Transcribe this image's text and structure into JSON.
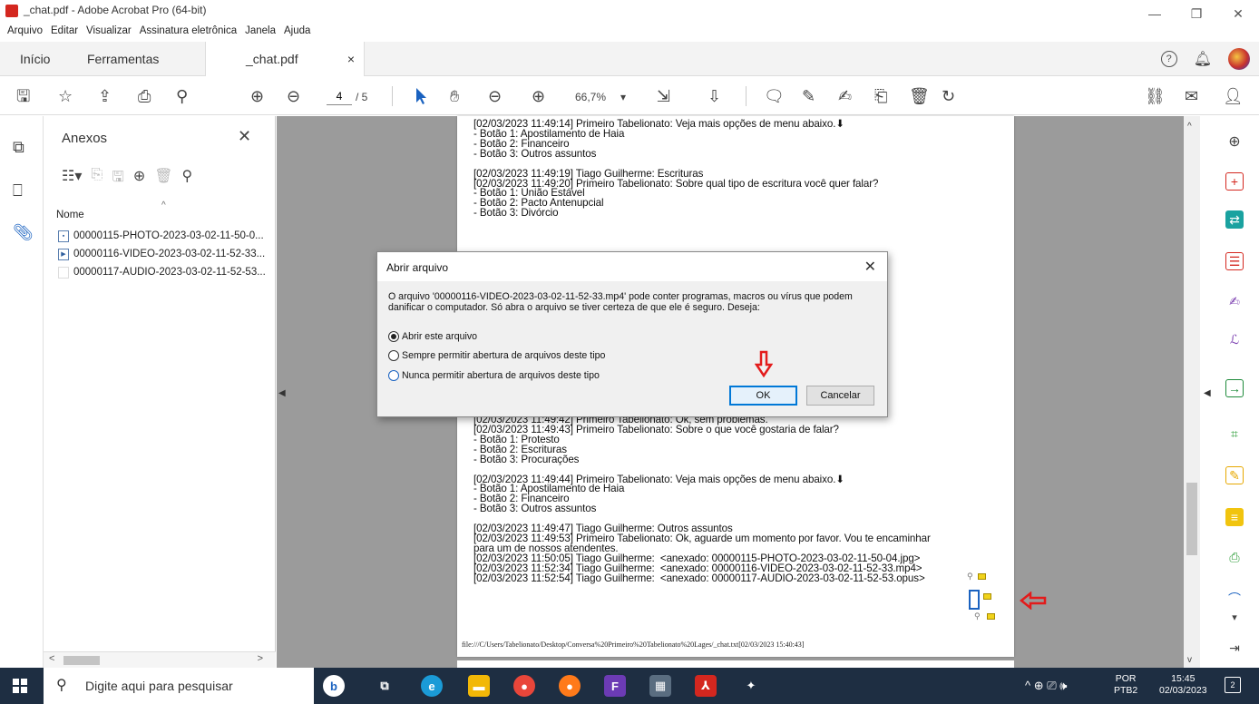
{
  "window": {
    "title": "_chat.pdf - Adobe Acrobat Pro (64-bit)",
    "controls": [
      "—",
      "❐",
      "✕"
    ]
  },
  "menu": [
    "Arquivo",
    "Editar",
    "Visualizar",
    "Assinatura eletrônica",
    "Janela",
    "Ajuda"
  ],
  "tabs": {
    "home": "Início",
    "tools": "Ferramentas",
    "document": "_chat.pdf",
    "close": "×"
  },
  "toolbar": {
    "current_page": "4",
    "total_pages": "/ 5",
    "zoom": "66,7%",
    "zoom_arrow": "▾"
  },
  "attachments_panel": {
    "title": "Anexos",
    "close": "✕",
    "column_header": "Nome",
    "sort_indicator": "^",
    "files": [
      {
        "name": "00000115-PHOTO-2023-03-02-11-50-0...",
        "icon": "image-file-icon"
      },
      {
        "name": "00000116-VIDEO-2023-03-02-11-52-33...",
        "icon": "video-file-icon"
      },
      {
        "name": "00000117-AUDIO-2023-03-02-11-52-53...",
        "icon": "audio-file-icon"
      }
    ],
    "scroll_left": "<",
    "scroll_right": ">"
  },
  "document": {
    "chat_lines": [
      "[02/03/2023 11:49:14] Primeiro Tabelionato: Veja mais opções de menu abaixo.⬇",
      "- Botão 1: Apostilamento de Haia",
      "- Botão 2: Financeiro",
      "- Botão 3: Outros assuntos",
      "",
      "[02/03/2023 11:49:19] Tiago Guilherme: Escrituras",
      "[02/03/2023 11:49:20] Primeiro Tabelionato: Sobre qual tipo de escritura você quer falar?",
      "- Botão 1: União Estável",
      "- Botão 2: Pacto Antenupcial",
      "- Botão 3: Divórcio"
    ],
    "chat_lines_lower": [
      "[02/03/2023 11:49:42] Primeiro Tabelionato: Ok, sem problemas.",
      "[02/03/2023 11:49:43] Primeiro Tabelionato: Sobre o que você gostaria de falar?",
      "- Botão 1: Protesto",
      "- Botão 2: Escrituras",
      "- Botão 3: Procurações",
      "",
      "[02/03/2023 11:49:44] Primeiro Tabelionato: Veja mais opções de menu abaixo.⬇",
      "- Botão 1: Apostilamento de Haia",
      "- Botão 2: Financeiro",
      "- Botão 3: Outros assuntos",
      "",
      "[02/03/2023 11:49:47] Tiago Guilherme: Outros assuntos",
      "[02/03/2023 11:49:53] Primeiro Tabelionato: Ok, aguarde um momento por favor. Vou te encaminhar",
      "para um de nossos atendentes.",
      "[02/03/2023 11:50:05] Tiago Guilherme:  <anexado: 00000115-PHOTO-2023-03-02-11-50-04.jpg>",
      "[02/03/2023 11:52:34] Tiago Guilherme:  <anexado: 00000116-VIDEO-2023-03-02-11-52-33.mp4>",
      "[02/03/2023 11:52:54] Tiago Guilherme:  <anexado: 00000117-AUDIO-2023-03-02-11-52-53.opus>"
    ],
    "footer": "file:///C/Users/Tabelionato/Desktop/Conversa%20Primeiro%20Tabelionato%20Lages/_chat.txt[02/03/2023 15:40:43]"
  },
  "dialog": {
    "title": "Abrir arquivo",
    "close": "✕",
    "message": "O arquivo '00000116-VIDEO-2023-03-02-11-52-33.mp4' pode conter programas, macros ou vírus que podem danificar o computador. Só abra o arquivo se tiver certeza de que ele é seguro. Deseja:",
    "options": [
      "Abrir este arquivo",
      "Sempre permitir abertura de arquivos deste tipo",
      "Nunca permitir abertura de arquivos deste tipo"
    ],
    "selected_option": 0,
    "ok": "OK",
    "cancel": "Cancelar"
  },
  "taskbar": {
    "search_placeholder": "Digite aqui para pesquisar",
    "language_top": "POR",
    "language_bottom": "PTB2",
    "time": "15:45",
    "date": "02/03/2023",
    "notifications": "2",
    "tray_icons": "^ ⊕ ⎚ 🕪"
  },
  "colors": {
    "accent_blue": "#0078d7",
    "annotation_red": "#e31b1b",
    "acrobat_red": "#d4271f",
    "taskbar_bg": "#1e2e42"
  }
}
